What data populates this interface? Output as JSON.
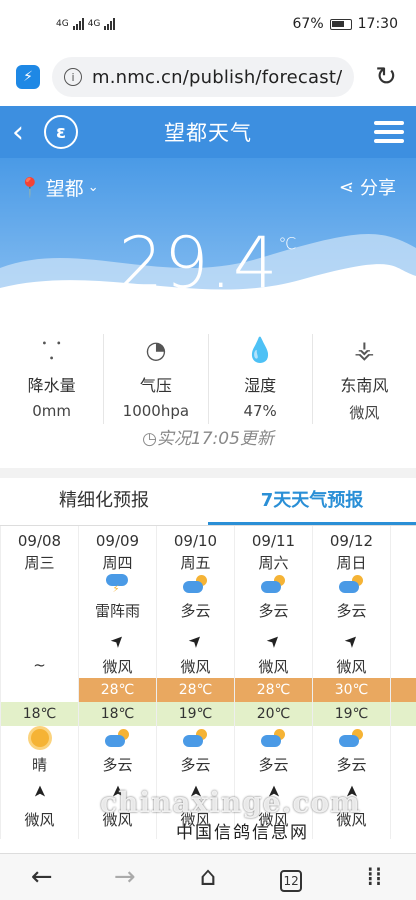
{
  "status_bar": {
    "signal1": "4G",
    "signal2": "4G",
    "battery": "67%",
    "time": "17:30"
  },
  "browser": {
    "url": "m.nmc.cn/publish/forecast//"
  },
  "header": {
    "back": "‹",
    "title": "望都天气"
  },
  "hero": {
    "location": "望都",
    "share_label": "分享",
    "temperature": "29.4",
    "temp_unit": "℃"
  },
  "stats": [
    {
      "label": "降水量",
      "value": "0mm",
      "icon": "raindrops-icon"
    },
    {
      "label": "气压",
      "value": "1000hpa",
      "icon": "gauge-icon"
    },
    {
      "label": "湿度",
      "value": "47%",
      "icon": "humidity-icon"
    },
    {
      "label": "东南风",
      "value": "微风",
      "icon": "wind-turbine-icon"
    }
  ],
  "observed_time": "实况17:05更新",
  "tabs": [
    {
      "label": "精细化预报",
      "active": false
    },
    {
      "label": "7天天气预报",
      "active": true
    }
  ],
  "forecast": [
    {
      "date": "09/08",
      "week": "周三",
      "day_weather": "",
      "day_wind": "~",
      "high": "",
      "low": "18℃",
      "night_weather": "晴",
      "night_wind": "微风",
      "day_icon": "",
      "night_icon": "sunny"
    },
    {
      "date": "09/09",
      "week": "周四",
      "day_weather": "雷阵雨",
      "day_wind": "微风",
      "high": "28℃",
      "low": "18℃",
      "night_weather": "多云",
      "night_wind": "微风",
      "day_icon": "storm",
      "night_icon": "cloudy"
    },
    {
      "date": "09/10",
      "week": "周五",
      "day_weather": "多云",
      "day_wind": "微风",
      "high": "28℃",
      "low": "19℃",
      "night_weather": "多云",
      "night_wind": "微风",
      "day_icon": "cloudy",
      "night_icon": "cloudy"
    },
    {
      "date": "09/11",
      "week": "周六",
      "day_weather": "多云",
      "day_wind": "微风",
      "high": "28℃",
      "low": "20℃",
      "night_weather": "多云",
      "night_wind": "微风",
      "day_icon": "cloudy",
      "night_icon": "cloudy"
    },
    {
      "date": "09/12",
      "week": "周日",
      "day_weather": "多云",
      "day_wind": "微风",
      "high": "30℃",
      "low": "19℃",
      "night_weather": "多云",
      "night_wind": "微风",
      "day_icon": "cloudy",
      "night_icon": "cloudy"
    },
    {
      "date": "0",
      "week": "周",
      "day_weather": "雷",
      "day_wind": "微",
      "high": "2",
      "low": "1",
      "night_weather": "雷",
      "night_wind": "微",
      "day_icon": "",
      "night_icon": ""
    }
  ],
  "watermark": {
    "line1": "chinaxinge.com",
    "line2": "中国信鸽信息网"
  },
  "bottom_nav": {
    "tab_count": "12"
  },
  "colors": {
    "primary": "#3d8fe0",
    "high_band": "#e9a860",
    "low_band": "#e3f0c9",
    "active_tab": "#2a8fd6"
  }
}
